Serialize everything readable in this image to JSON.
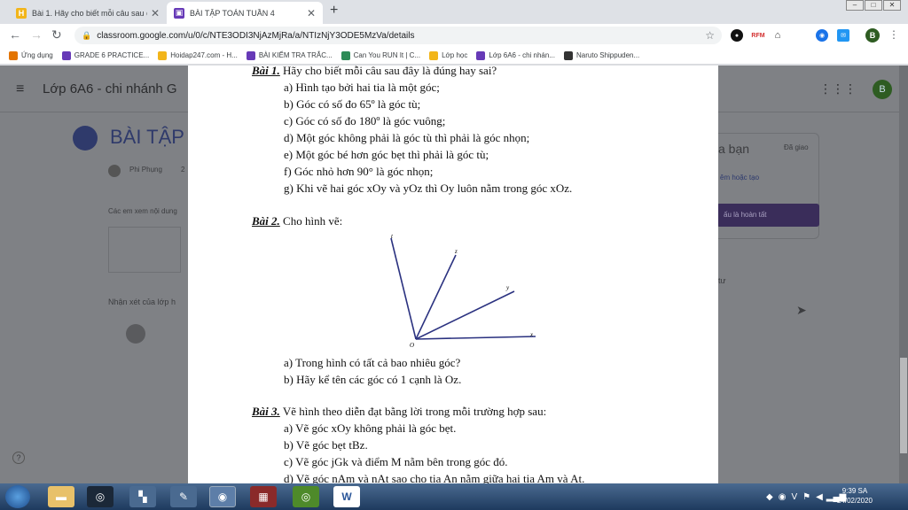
{
  "browser": {
    "tabs": [
      {
        "title": "Bài 1. Hãy cho biết mỗi câu sau đ",
        "favicon_color": "#f2b51a",
        "favicon_glyph": "H"
      },
      {
        "title": "BÀI TẬP TOÁN TUẦN 4",
        "favicon_color": "#673ab7",
        "favicon_glyph": "▣"
      }
    ],
    "new_tab": "+",
    "url": "classroom.google.com/u/0/c/NTE3ODI3NjAzMjRa/a/NTIzNjY3ODE5MzVa/details",
    "profile_initial": "B"
  },
  "bookmarks": [
    {
      "label": "Ứng dụng",
      "color": "#e37400"
    },
    {
      "label": "GRADE 6 PRACTICE...",
      "color": "#673ab7"
    },
    {
      "label": "Hoidap247.com - H...",
      "color": "#f2b51a"
    },
    {
      "label": "BÀI KIỂM TRA TRẮC...",
      "color": "#673ab7"
    },
    {
      "label": "Can You RUN It | C...",
      "color": "#2e8b57"
    },
    {
      "label": "Lớp học",
      "color": "#f2b51a"
    },
    {
      "label": "Lớp 6A6 - chi nhán...",
      "color": "#673ab7"
    },
    {
      "label": "Naruto Shippuden...",
      "color": "#333333"
    }
  ],
  "classroom": {
    "class_name": "Lớp 6A6 - chi nhánh G",
    "assignment_title": "BÀI TẬP",
    "teacher": "Phi Phụng",
    "date_fragment": "2",
    "desc_fragment": "Các em xem nội dung",
    "comments_label": "Nhận xét của lớp h",
    "right_header": "a bạn",
    "right_status": "Đã giao",
    "right_link": "êm hoặc tạo",
    "right_button": "ấu là hoàn tất",
    "private_label": "tư",
    "profile_initial": "B"
  },
  "document": {
    "bai1_label": "Bài 1.",
    "bai1_text": "Hãy cho biết mỗi câu sau đây là đúng hay sai?",
    "bai1_items": [
      "a) Hình tạo bởi hai tia là một góc;",
      "b) Góc có số đo 65º là góc tù;",
      "c) Góc có số đo 180º là góc vuông;",
      "d) Một góc không phải là góc tù thì phải là góc nhọn;",
      "e) Một góc bé hơn góc bẹt thì phải là góc tù;",
      "f) Góc nhỏ hơn 90° là góc nhọn;",
      "g) Khi vẽ hai góc xOy và yOz thì Oy luôn nằm trong góc xOz."
    ],
    "bai2_label": "Bài 2.",
    "bai2_text": "Cho hình vẽ:",
    "figure_labels": {
      "t": "t",
      "z": "z",
      "y": "y",
      "x": "x",
      "o": "O"
    },
    "bai2_items": [
      "a) Trong hình có tất cả bao nhiêu góc?",
      "b) Hãy kể tên các góc có 1 cạnh là Oz."
    ],
    "bai3_label": "Bài 3.",
    "bai3_text": "Vẽ hình theo diễn đạt bằng lời trong mỗi trường hợp sau:",
    "bai3_items": [
      "a) Vẽ góc xOy không phải là góc bẹt.",
      "b) Vẽ góc bẹt tBz.",
      "c) Vẽ góc jGk và điểm M nằm bên trong góc đó.",
      "d) Vẽ góc nAm và nAt sao cho tia An nằm giữa hai tia Am và At."
    ]
  },
  "taskbar": {
    "time": "9:39 SA",
    "date": "24/02/2020"
  }
}
